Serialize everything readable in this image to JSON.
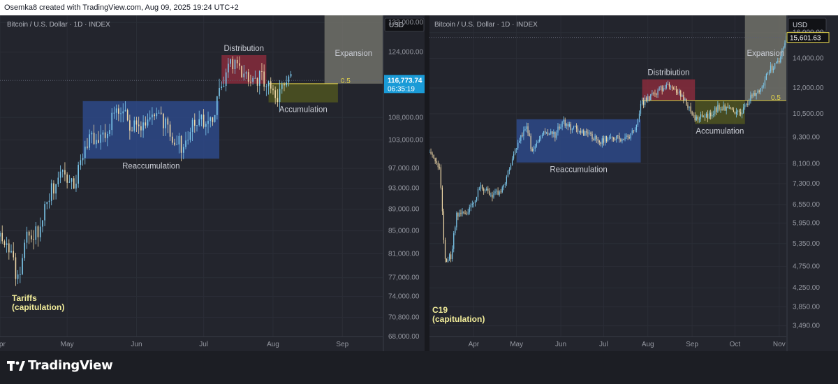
{
  "header": {
    "attribution": "Osemka8 created with TradingView.com, Aug 09, 2025 19:24 UTC+2"
  },
  "footer": {
    "brand": "TradingView"
  },
  "colors": {
    "background": "#23252d",
    "grid": "#2b2e37",
    "bull": "#7ecbf0",
    "bear": "#f0d9a8",
    "price_tag": "#1a9bd7",
    "fib_line": "#e4d44a",
    "zone_reaccumulation": "#2e4b8f",
    "zone_distribution": "#8f2c3c",
    "zone_accumulation": "#52571f",
    "zone_expansion": "#77776e",
    "annotation_text": "#f2ed9a"
  },
  "chart_data": [
    {
      "type": "candlestick",
      "symbol": "Bitcoin / U.S. Dollar · 1D · INDEX",
      "currency": "USD",
      "scale": "log",
      "ylim": [
        68000,
        134000
      ],
      "yticks": [
        "132,000.00",
        "124,000.00",
        "116,773.74",
        "108,000.00",
        "103,000.00",
        "97,000.00",
        "93,000.00",
        "89,000.00",
        "85,000.00",
        "81,000.00",
        "77,000.00",
        "74,000.00",
        "70,800.00",
        "68,000.00"
      ],
      "ytick_values": [
        132000,
        124000,
        108000,
        103000,
        97000,
        93000,
        89000,
        85000,
        81000,
        77000,
        74000,
        70800,
        68000
      ],
      "last_price": "116,773.74",
      "last_price_value": 116773.74,
      "countdown": "06:35:19",
      "xlabels": [
        "Apr",
        "May",
        "Jun",
        "Jul",
        "Aug",
        "Sep"
      ],
      "x_domain": [
        "2025-04-01",
        "2025-09-19"
      ],
      "x_label_dates": [
        "2025-04-01",
        "2025-05-01",
        "2025-06-01",
        "2025-07-01",
        "2025-08-01",
        "2025-09-01"
      ],
      "fib_level": "0.5",
      "fib_value": 116000,
      "fib_range": [
        "2025-07-30",
        "2025-08-30"
      ],
      "price_path": [
        [
          "2025-04-01",
          84000
        ],
        [
          "2025-04-05",
          82500
        ],
        [
          "2025-04-09",
          76500
        ],
        [
          "2025-04-13",
          84500
        ],
        [
          "2025-04-18",
          84800
        ],
        [
          "2025-04-22",
          91500
        ],
        [
          "2025-04-27",
          94500
        ],
        [
          "2025-05-01",
          95500
        ],
        [
          "2025-05-05",
          94200
        ],
        [
          "2025-05-08",
          100000
        ],
        [
          "2025-05-12",
          103500
        ],
        [
          "2025-05-18",
          103800
        ],
        [
          "2025-05-22",
          109500
        ],
        [
          "2025-05-28",
          107500
        ],
        [
          "2025-06-02",
          104500
        ],
        [
          "2025-06-09",
          109000
        ],
        [
          "2025-06-15",
          105500
        ],
        [
          "2025-06-22",
          101000
        ],
        [
          "2025-06-27",
          107200
        ],
        [
          "2025-07-01",
          106800
        ],
        [
          "2025-07-05",
          108500
        ],
        [
          "2025-07-10",
          116500
        ],
        [
          "2025-07-14",
          121500
        ],
        [
          "2025-07-20",
          118500
        ],
        [
          "2025-07-25",
          117500
        ],
        [
          "2025-07-31",
          116500
        ],
        [
          "2025-08-02",
          112800
        ],
        [
          "2025-08-05",
          114000
        ],
        [
          "2025-08-09",
          116773
        ]
      ],
      "zones": [
        {
          "label": "Reaccumulation",
          "start": "2025-05-08",
          "end": "2025-07-08",
          "low": 99000,
          "high": 111800,
          "color": "#2e4b8f",
          "label_pos": "below"
        },
        {
          "label": "Distribution",
          "start": "2025-07-09",
          "end": "2025-07-29",
          "low": 116000,
          "high": 123200,
          "color": "#8f2c3c",
          "label_pos": "above"
        },
        {
          "label": "Accumulation",
          "start": "2025-07-30",
          "end": "2025-08-30",
          "low": 111500,
          "high": 116000,
          "color": "#52571f",
          "label_pos": "below"
        },
        {
          "label": "Expansion",
          "start": "2025-08-24",
          "end": "2025-09-19",
          "low": 116000,
          "high": 134000,
          "color": "#77776e",
          "label_pos": "inside"
        }
      ],
      "annotation": {
        "lines": [
          "Tariffs",
          "(capitulation)"
        ],
        "date": "2025-04-03"
      }
    },
    {
      "type": "candlestick",
      "symbol": "Bitcoin / U.S. Dollar · 1D · INDEX",
      "currency": "USD",
      "scale": "log",
      "ylim": [
        3300,
        17500
      ],
      "yticks": [
        "16,000.00",
        "15,601.63",
        "14,000.00",
        "12,000.00",
        "10,500.00",
        "9,300.00",
        "8,100.00",
        "7,300.00",
        "6,550.00",
        "5,950.00",
        "5,350.00",
        "4,750.00",
        "4,250.00",
        "3,850.00",
        "3,490.00"
      ],
      "ytick_values": [
        16000,
        14000,
        12000,
        10500,
        9300,
        8100,
        7300,
        6550,
        5950,
        5350,
        4750,
        4250,
        3850,
        3490
      ],
      "last_price": "15,601.63",
      "last_price_value": 15601.63,
      "xlabels": [
        "Apr",
        "May",
        "Jun",
        "Jul",
        "Aug",
        "Sep",
        "Oct",
        "Nov"
      ],
      "x_domain": [
        "2020-03-01",
        "2020-11-06"
      ],
      "x_label_dates": [
        "2020-04-01",
        "2020-05-01",
        "2020-06-01",
        "2020-07-01",
        "2020-08-01",
        "2020-09-01",
        "2020-10-01",
        "2020-11-01"
      ],
      "fib_level": "0.5",
      "fib_value": 11250,
      "fib_range": [
        "2020-07-28",
        "2020-11-06"
      ],
      "price_path": [
        [
          "2020-03-01",
          8600
        ],
        [
          "2020-03-08",
          8000
        ],
        [
          "2020-03-12",
          4900
        ],
        [
          "2020-03-16",
          5000
        ],
        [
          "2020-03-20",
          6200
        ],
        [
          "2020-03-28",
          6300
        ],
        [
          "2020-04-06",
          7200
        ],
        [
          "2020-04-14",
          6800
        ],
        [
          "2020-04-22",
          7200
        ],
        [
          "2020-04-30",
          8700
        ],
        [
          "2020-05-08",
          9900
        ],
        [
          "2020-05-12",
          8600
        ],
        [
          "2020-05-20",
          9500
        ],
        [
          "2020-05-28",
          9400
        ],
        [
          "2020-06-02",
          10100
        ],
        [
          "2020-06-10",
          9700
        ],
        [
          "2020-06-20",
          9400
        ],
        [
          "2020-06-28",
          9100
        ],
        [
          "2020-07-06",
          9300
        ],
        [
          "2020-07-14",
          9200
        ],
        [
          "2020-07-22",
          9500
        ],
        [
          "2020-07-27",
          11000
        ],
        [
          "2020-08-05",
          11700
        ],
        [
          "2020-08-17",
          12200
        ],
        [
          "2020-08-25",
          11500
        ],
        [
          "2020-09-03",
          10200
        ],
        [
          "2020-09-12",
          10400
        ],
        [
          "2020-09-20",
          10900
        ],
        [
          "2020-09-28",
          10700
        ],
        [
          "2020-10-06",
          10600
        ],
        [
          "2020-10-12",
          11400
        ],
        [
          "2020-10-20",
          12000
        ],
        [
          "2020-10-25",
          13200
        ],
        [
          "2020-11-01",
          13800
        ],
        [
          "2020-11-06",
          15600
        ]
      ],
      "zones": [
        {
          "label": "Reaccumulation",
          "start": "2020-05-01",
          "end": "2020-07-27",
          "low": 8150,
          "high": 10200,
          "color": "#2e4b8f",
          "label_pos": "below"
        },
        {
          "label": "Distribiution",
          "start": "2020-07-28",
          "end": "2020-09-03",
          "low": 11250,
          "high": 12550,
          "color": "#8f2c3c",
          "label_pos": "above"
        },
        {
          "label": "Accumulation",
          "start": "2020-09-03",
          "end": "2020-10-08",
          "low": 9950,
          "high": 11250,
          "color": "#52571f",
          "label_pos": "below"
        },
        {
          "label": "Expansion",
          "start": "2020-10-08",
          "end": "2020-11-06",
          "low": 11250,
          "high": 17500,
          "color": "#77776e",
          "label_pos": "inside"
        }
      ],
      "annotation": {
        "lines": [
          "C19",
          "(capitulation)"
        ],
        "date": "2020-03-12"
      }
    }
  ]
}
